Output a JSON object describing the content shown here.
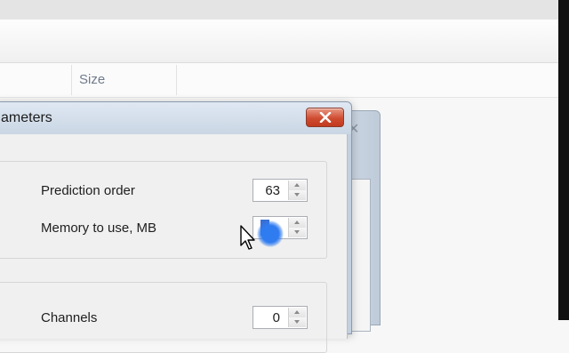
{
  "explorer": {
    "column_header_size": "Size"
  },
  "dialog": {
    "title": "ameters",
    "close_icon": "close-icon"
  },
  "fields": {
    "prediction_order": {
      "label": "Prediction order",
      "value": "63"
    },
    "memory": {
      "label": "Memory to use, MB",
      "value": ""
    },
    "channels": {
      "label": "Channels",
      "value": "0"
    }
  },
  "colors": {
    "close_button": "#cf4c31",
    "selection": "#3a6fd6",
    "click_highlight": "#2f7bf0"
  }
}
